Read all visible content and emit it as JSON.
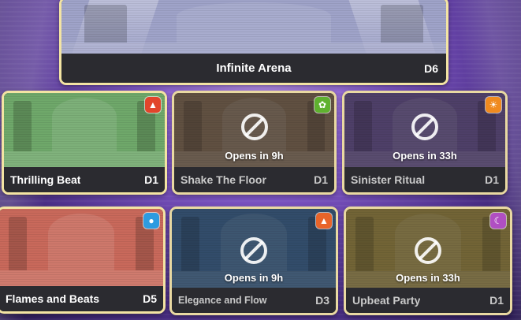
{
  "arena": {
    "name": "Infinite Arena",
    "difficulty": "D6",
    "thumb_color": "#9fa3c9"
  },
  "stages": [
    {
      "id": "thrilling-beat",
      "name": "Thrilling Beat",
      "difficulty": "D1",
      "locked": false,
      "opens": "",
      "attribute_icon": "fire-icon",
      "attribute_color": "#e2452b",
      "thumb_color": "#6fa86a"
    },
    {
      "id": "shake-the-floor",
      "name": "Shake The Floor",
      "difficulty": "D1",
      "locked": true,
      "opens": "Opens in 9h",
      "attribute_icon": "leaf-icon",
      "attribute_color": "#5fb12f",
      "thumb_color": "#8a7058"
    },
    {
      "id": "sinister-ritual",
      "name": "Sinister Ritual",
      "difficulty": "D1",
      "locked": true,
      "opens": "Opens in 33h",
      "attribute_icon": "sun-icon",
      "attribute_color": "#f08a1f",
      "thumb_color": "#6d5596"
    },
    {
      "id": "flames-and-beats",
      "name": "Flames and Beats",
      "difficulty": "D5",
      "locked": false,
      "opens": "",
      "attribute_icon": "water-drop-icon",
      "attribute_color": "#2e9be0",
      "thumb_color": "#c9695b"
    },
    {
      "id": "elegance-and-flow",
      "name": "Elegance and Flow",
      "difficulty": "D3",
      "locked": true,
      "opens": "Opens in 9h",
      "attribute_icon": "mountain-icon",
      "attribute_color": "#e8642a",
      "thumb_color": "#3f6a9a"
    },
    {
      "id": "upbeat-party",
      "name": "Upbeat Party",
      "difficulty": "D1",
      "locked": true,
      "opens": "Opens in 33h",
      "attribute_icon": "moon-icon",
      "attribute_color": "#b04fc2",
      "thumb_color": "#a69046"
    }
  ]
}
